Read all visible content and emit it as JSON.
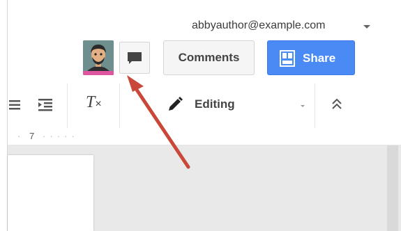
{
  "header": {
    "account_email": "abbyauthor@example.com",
    "comments_label": "Comments",
    "share_label": "Share"
  },
  "toolbar": {
    "mode_label": "Editing"
  },
  "ruler": {
    "number": "7"
  },
  "colors": {
    "share_blue": "#4a8af4",
    "annotation_arrow": "#c9483a"
  },
  "icons": [
    "avatar",
    "chat-bubble-icon",
    "share-people-icon",
    "list-icon",
    "indent-icon",
    "clear-formatting-icon",
    "pencil-icon",
    "collapse-icon"
  ]
}
